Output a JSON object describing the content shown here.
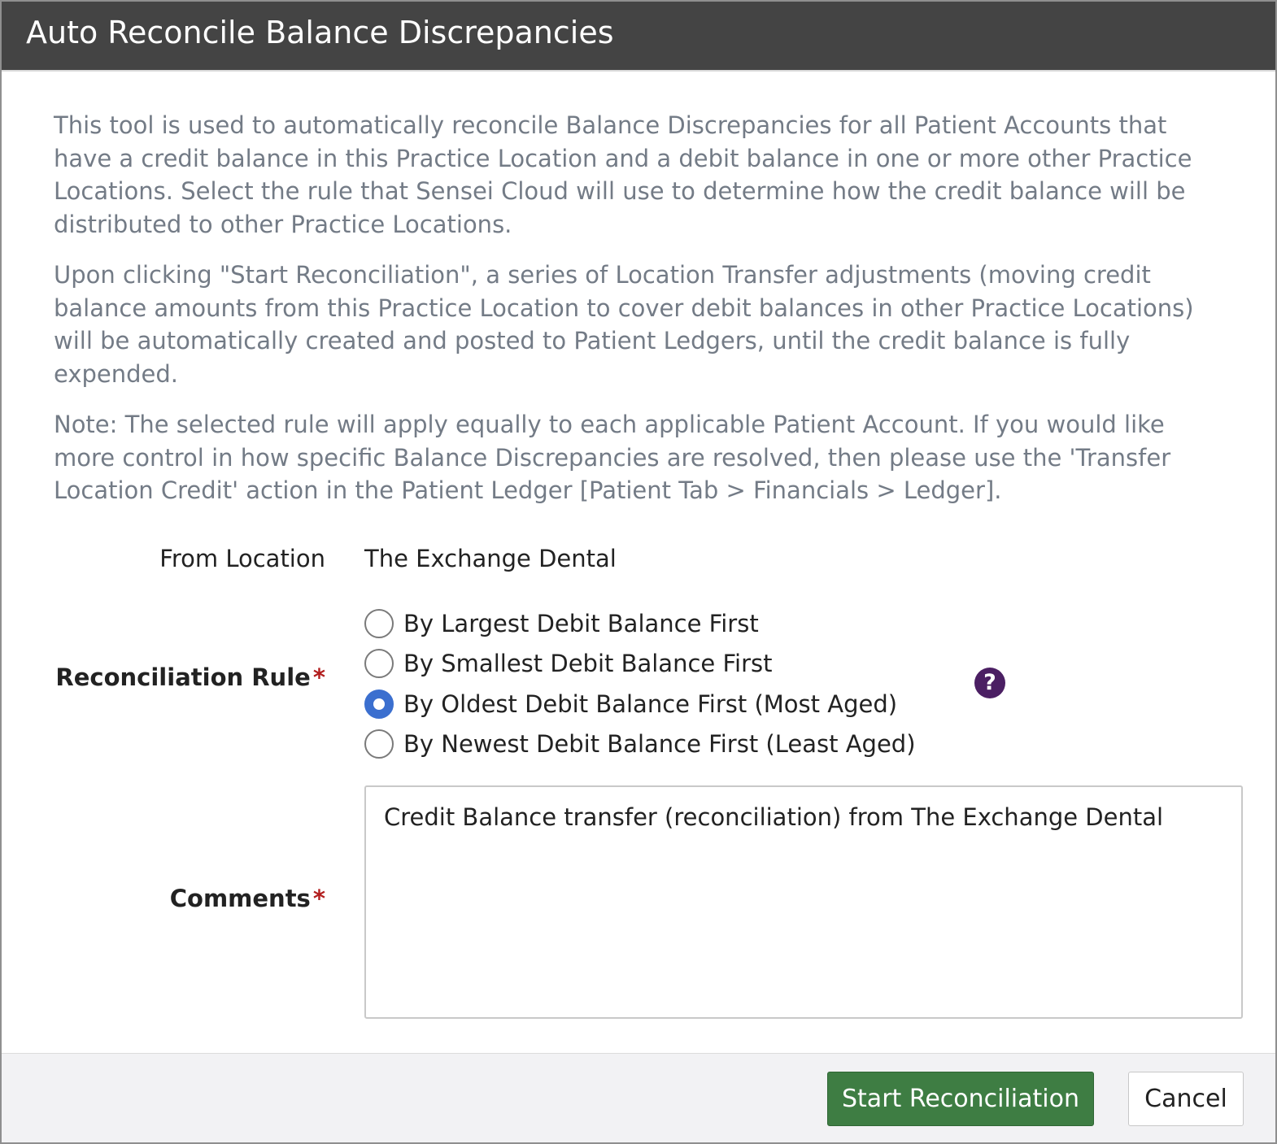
{
  "dialog": {
    "title": "Auto Reconcile Balance Discrepancies"
  },
  "intro": {
    "paragraph1": "This tool is used to automatically reconcile Balance Discrepancies for all Patient Accounts that have a credit balance in this Practice Location and a debit balance in one or more other Practice Locations. Select the rule that Sensei Cloud will use to determine how the credit balance will be distributed to other Practice Locations.",
    "paragraph2": "Upon clicking \"Start Reconciliation\", a series of Location Transfer adjustments (moving credit balance amounts from this Practice Location to cover debit balances in other Practice Locations) will be automatically created and posted to Patient Ledgers, until the credit balance is fully expended.",
    "paragraph3": "Note: The selected rule will apply equally to each applicable Patient Account. If you would like more control in how specific Balance Discrepancies are resolved, then please use the 'Transfer Location Credit' action in the Patient Ledger [Patient Tab > Financials > Ledger]."
  },
  "form": {
    "from_location_label": "From Location",
    "from_location_value": "The Exchange Dental",
    "rule_label": "Reconciliation Rule",
    "required_mark": "*",
    "rule_options": [
      {
        "label": "By Largest Debit Balance First",
        "checked": false
      },
      {
        "label": "By Smallest Debit Balance First",
        "checked": false
      },
      {
        "label": "By Oldest Debit Balance First (Most Aged)",
        "checked": true
      },
      {
        "label": "By Newest Debit Balance First (Least Aged)",
        "checked": false
      }
    ],
    "help_icon": "question-mark-circle-icon",
    "help_glyph": "?",
    "comments_label": "Comments",
    "comments_value": "Credit Balance transfer (reconciliation) from The Exchange Dental"
  },
  "footer": {
    "start_label": "Start Reconciliation",
    "cancel_label": "Cancel"
  },
  "colors": {
    "titlebar": "#444444",
    "primary_button": "#3e7d43",
    "radio_selected": "#3b6fcf",
    "help_icon": "#4b1f63",
    "required": "#b21e1e"
  }
}
